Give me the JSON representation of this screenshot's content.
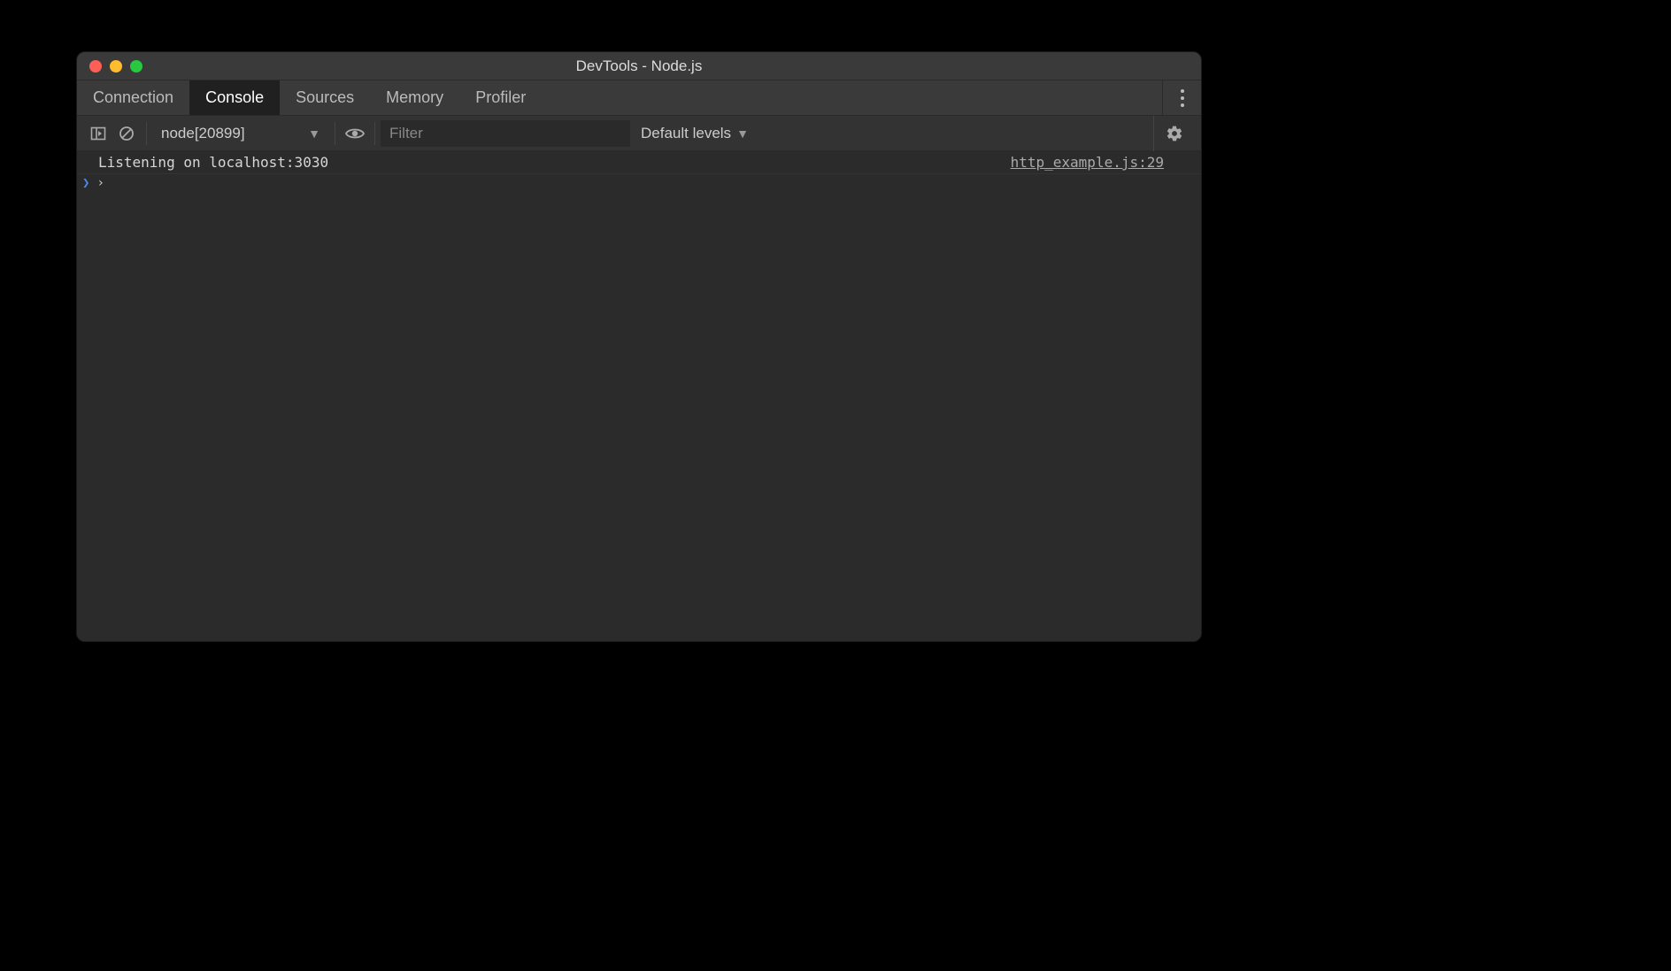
{
  "window": {
    "title": "DevTools - Node.js"
  },
  "tabs": [
    {
      "label": "Connection",
      "active": false
    },
    {
      "label": "Console",
      "active": true
    },
    {
      "label": "Sources",
      "active": false
    },
    {
      "label": "Memory",
      "active": false
    },
    {
      "label": "Profiler",
      "active": false
    }
  ],
  "toolbar": {
    "context": "node[20899]",
    "filter_placeholder": "Filter",
    "level_label": "Default levels"
  },
  "console": {
    "log_message": "Listening on localhost:3030",
    "log_source": "http_example.js:29"
  }
}
